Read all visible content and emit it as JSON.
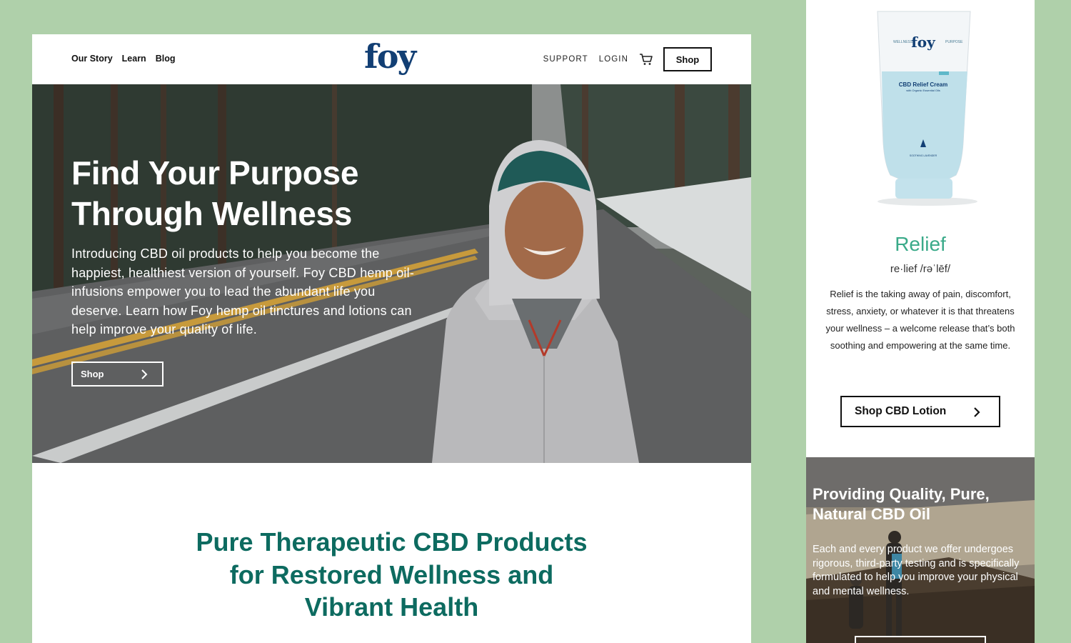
{
  "nav": {
    "left_links": [
      "Our Story",
      "Learn",
      "Blog"
    ],
    "logo": "foy",
    "support": "SUPPORT",
    "login": "LOGIN",
    "cart_icon": "cart-icon",
    "shop_button": "Shop"
  },
  "hero": {
    "title_line1": "Find Your Purpose",
    "title_line2": "Through Wellness",
    "body": "Introducing CBD oil products to help you become the happiest, healthiest version of yourself. Foy CBD hemp oil-infusions empower you to lead the abundant life you deserve. Learn how Foy hemp oil tinctures and lotions can help improve your quality of life.",
    "button": "Shop",
    "button_icon": "chevron-right-icon"
  },
  "section": {
    "title_line1": "Pure Therapeutic CBD Products",
    "title_line2": "for Restored Wellness and",
    "title_line3": "Vibrant Health"
  },
  "product": {
    "tube_brand": "foy",
    "tube_top_left": "WELLNESS",
    "tube_top_right": "PURPOSE",
    "tube_name": "CBD Relief Cream",
    "tube_sub": "with Organic Essential Oils",
    "tube_scent": "SOOTHING LAVENDER",
    "title": "Relief",
    "phonetic": "re·lief /rəˈlēf/",
    "description": "Relief is the taking away of pain, discomfort, stress, anxiety, or whatever it is that threatens your wellness – a welcome release that’s both soothing and empowering at the same time.",
    "button": "Shop CBD Lotion"
  },
  "promo": {
    "title_line1": "Providing Quality, Pure,",
    "title_line2": "Natural CBD Oil",
    "body": "Each and every product we offer undergoes rigorous, third-party testing and is specifically formulated to help you improve your physical and mental wellness."
  },
  "colors": {
    "background": "#afd0aa",
    "brand_navy": "#123f74",
    "teal_heading": "#0d6b60",
    "relief_green": "#3aaa89"
  }
}
